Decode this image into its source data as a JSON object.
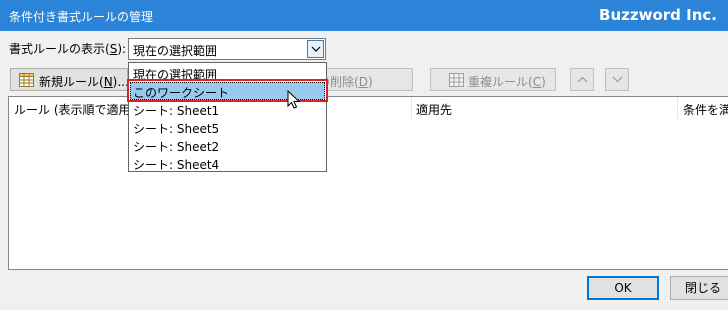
{
  "window": {
    "title": "条件付き書式ルールの管理",
    "brand": "Buzzword Inc."
  },
  "scope": {
    "label_pre": "書式ルールの表示(",
    "label_key": "S",
    "label_post": "):",
    "selected": "現在の選択範囲",
    "options": [
      "現在の選択範囲",
      "このワークシート",
      "シート: Sheet1",
      "シート: Sheet5",
      "シート: Sheet2",
      "シート: Sheet4"
    ],
    "highlighted_option": "このワークシート"
  },
  "toolbar": {
    "new_rule_pre": "新規ルール(",
    "new_rule_key": "N",
    "new_rule_post": ")...",
    "delete_rule_pre": "ルールの削除(",
    "delete_rule_key": "D",
    "delete_rule_post": ")",
    "duplicate_rule_pre": "重複ルール(",
    "duplicate_rule_key": "C",
    "duplicate_rule_post": ")"
  },
  "table": {
    "col_rule": "ルール (表示順で適用)",
    "col_applies_to": "適用先",
    "col_stop_if_true": "条件を満"
  },
  "buttons": {
    "ok": "OK",
    "close": "閉じる"
  },
  "colors": {
    "titlebar": "#2b84d8",
    "highlight": "#99c9ef",
    "annotation": "#e0201c"
  }
}
